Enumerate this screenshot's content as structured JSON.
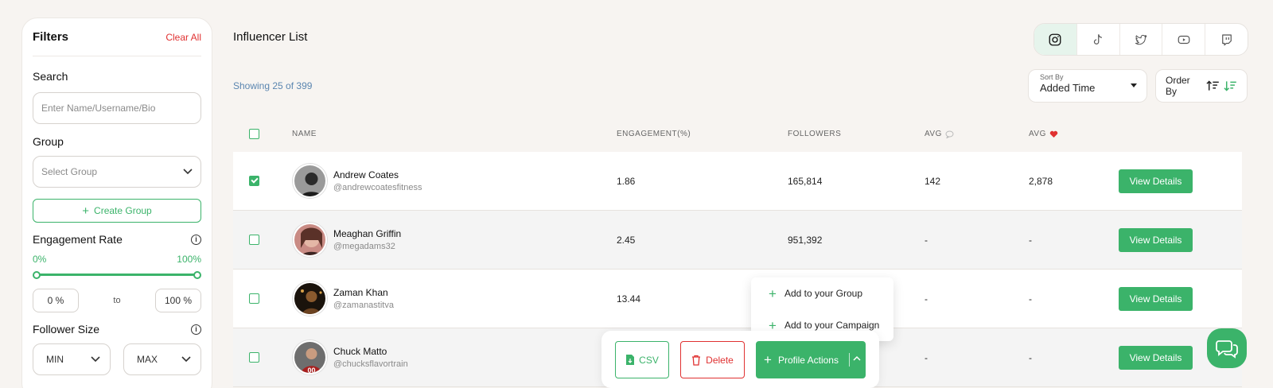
{
  "filters": {
    "title": "Filters",
    "clear_all": "Clear All",
    "search_label": "Search",
    "search_placeholder": "Enter Name/Username/Bio",
    "group_label": "Group",
    "group_placeholder": "Select Group",
    "create_group": "Create Group",
    "engagement_label": "Engagement Rate",
    "engagement_min_label": "0%",
    "engagement_max_label": "100%",
    "engagement_min_value": "0 %",
    "engagement_max_value": "100 %",
    "engagement_range_pct": [
      0,
      100
    ],
    "to_label": "to",
    "follower_label": "Follower Size",
    "follower_min": "MIN",
    "follower_max": "MAX"
  },
  "main": {
    "title": "Influencer List",
    "showing": "Showing 25 of 399",
    "platforms": [
      "instagram-icon",
      "tiktok-icon",
      "twitter-icon",
      "youtube-icon",
      "twitch-icon"
    ],
    "active_platform": "instagram",
    "sort_by_label": "Sort By",
    "sort_by_value": "Added Time",
    "order_by_label": "Order By"
  },
  "table": {
    "headers": {
      "name": "NAME",
      "engagement": "ENGAGEMENT(%)",
      "followers": "FOLLOWERS",
      "avg_comments": "AVG",
      "avg_likes": "AVG"
    },
    "rows": [
      {
        "name": "Andrew Coates",
        "handle": "@andrewcoatesfitness",
        "engagement": "1.86",
        "followers": "165,814",
        "avg_comments": "142",
        "avg_likes": "2,878",
        "checked": true,
        "action": "View Details"
      },
      {
        "name": "Meaghan Griffin",
        "handle": "@megadams32",
        "engagement": "2.45",
        "followers": "951,392",
        "avg_comments": "-",
        "avg_likes": "-",
        "checked": false,
        "action": "View Details"
      },
      {
        "name": "Zaman Khan",
        "handle": "@zamanastitva",
        "engagement": "13.44",
        "followers": "",
        "avg_comments": "-",
        "avg_likes": "-",
        "checked": false,
        "action": "View Details"
      },
      {
        "name": "Chuck Matto",
        "handle": "@chucksflavortrain",
        "engagement": "",
        "followers": "",
        "avg_comments": "-",
        "avg_likes": "-",
        "checked": false,
        "action": "View Details"
      }
    ]
  },
  "dropdown": {
    "items": [
      "Add to your Group",
      "Add to your Campaign"
    ]
  },
  "actionbar": {
    "csv": "CSV",
    "delete": "Delete",
    "profile_actions": "Profile Actions"
  },
  "colors": {
    "accent": "#3bb36a",
    "danger": "#e03131",
    "muted_link": "#5b86b0",
    "background": "#f7f4f1"
  }
}
